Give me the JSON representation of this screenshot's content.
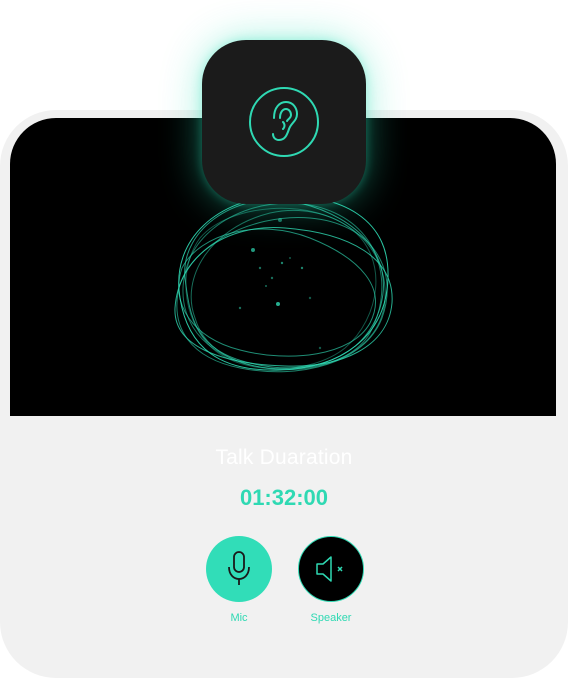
{
  "call": {
    "title": "Talk Duaration",
    "duration": "01:32:00"
  },
  "controls": {
    "mic_label": "Mic",
    "speaker_label": "Speaker",
    "mic_icon": "microphone-icon",
    "speaker_icon": "speaker-muted-icon"
  },
  "badge": {
    "icon": "ear-icon"
  },
  "colors": {
    "accent": "#2fd9b3",
    "card_bg": "#f1f1f1",
    "viz_bg": "#000000",
    "badge_bg": "#1b1b1b"
  }
}
